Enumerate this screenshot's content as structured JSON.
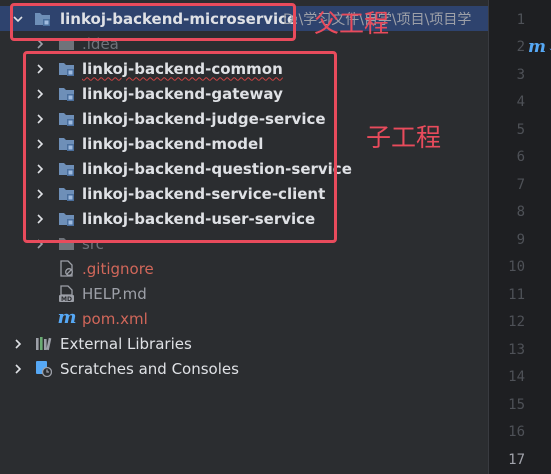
{
  "project_tree": {
    "root": {
      "name": "linkoj-backend-microservice",
      "path": "D:\\学习文件\\自学\\项目\\项目学"
    },
    "idea_folder": ".idea",
    "modules": [
      "linkoj-backend-common",
      "linkoj-backend-gateway",
      "linkoj-backend-judge-service",
      "linkoj-backend-model",
      "linkoj-backend-question-service",
      "linkoj-backend-service-client",
      "linkoj-backend-user-service"
    ],
    "src_folder": "src",
    "files": {
      "gitignore": ".gitignore",
      "help": "HELP.md",
      "pom": "pom.xml"
    },
    "external_libraries": "External Libraries",
    "scratches": "Scratches and Consoles"
  },
  "editor": {
    "line_numbers": [
      "1",
      "2",
      "3",
      "4",
      "5",
      "6",
      "7",
      "8",
      "9",
      "10",
      "11",
      "12",
      "13",
      "14",
      "15",
      "16",
      "17"
    ],
    "current_line": "17",
    "gutter_icon_glyph": "m↓"
  },
  "annotations": {
    "parent_label": "父工程",
    "child_label": "子工程",
    "color": "#e84b5c"
  },
  "colors": {
    "panel_bg": "#2b2d30",
    "editor_bg": "#1e1f22",
    "selection_bg": "#2e436e",
    "folder_icon": "#6e8fb8",
    "vcs_untracked": "#d1675a",
    "maven_icon": "#56a8f5"
  },
  "icons": {
    "root": "module-folder-icon",
    "idea": "folder-icon",
    "module": "module-folder-icon",
    "src": "folder-icon",
    "gitignore": "ignore-file-icon",
    "help": "markdown-file-icon",
    "pom": "maven-icon",
    "external_libraries": "library-icon",
    "scratches": "scratches-icon"
  }
}
